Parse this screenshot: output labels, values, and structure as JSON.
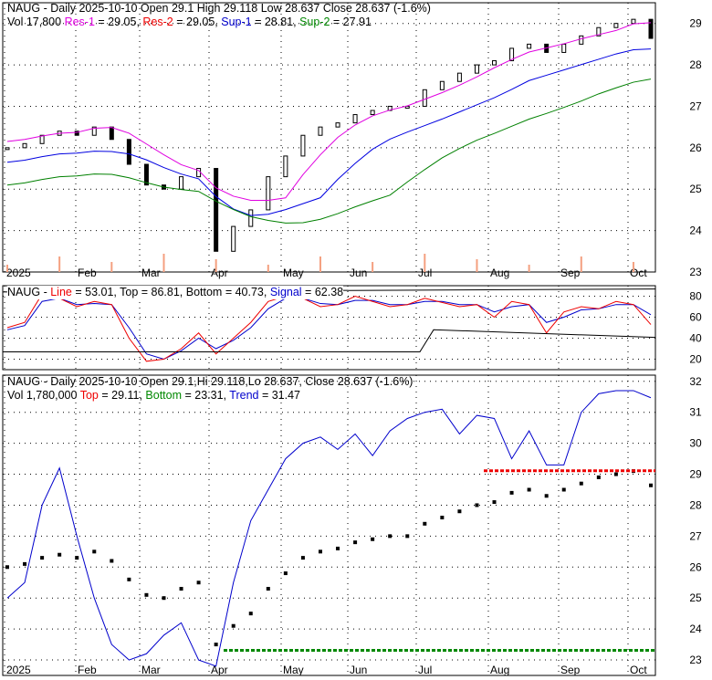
{
  "panel1": {
    "line1": "NAUG - Daily 2025-10-10 Open 29.1  High 29.118  Low 28.637  Close 28.637 (-1.6%)",
    "vol": "Vol 17,800",
    "res1_label": "Res-1",
    "res1": " = 29.05, ",
    "res2_label": "Res-2",
    "res2": " = 29.05, ",
    "sup1_label": "Sup-1",
    "sup1": " = 28.81, ",
    "sup2_label": "Sup-2",
    "sup2": " = 27.91"
  },
  "panel2": {
    "prefix": "NAUG - ",
    "line_label": "Line",
    "line": " = 53.01, Top = 86.81, Bottom = 40.73, ",
    "signal_label": "Signal",
    "signal": " = 62.38"
  },
  "panel3": {
    "line1": "NAUG - Daily 2025-10-10 Open 29.1,Hi 29.118,Lo 28.637, Close 28.637 (-1.6%)",
    "vol": "Vol 1,780,000 ",
    "top_label": "Top",
    "top": " = 29.11, ",
    "bottom_label": "Bottom",
    "bottom": " = 23.31, ",
    "trend_label": "Trend",
    "trend": " = 31.47"
  },
  "chart_data": [
    {
      "type": "line",
      "title": "NAUG - Daily price with support/resistance",
      "ylim": [
        23,
        29.5
      ],
      "y_ticks": [
        23,
        24,
        25,
        26,
        27,
        28,
        29
      ],
      "x_ticks": [
        "2025",
        "Feb",
        "Mar",
        "Apr",
        "May",
        "Jun",
        "Jul",
        "Aug",
        "Sep",
        "Oct"
      ],
      "close": [
        26,
        26.1,
        26.3,
        26.4,
        26.3,
        26.5,
        26.2,
        25.6,
        25.1,
        25.0,
        25.3,
        25.5,
        23.5,
        24.1,
        24.5,
        25.3,
        25.8,
        26.3,
        26.5,
        26.6,
        26.8,
        26.9,
        27.0,
        27.0,
        27.4,
        27.6,
        27.8,
        28.0,
        28.1,
        28.4,
        28.5,
        28.3,
        28.5,
        28.7,
        28.9,
        29.0,
        29.1,
        28.64
      ],
      "colors": {
        "res1": "#e000e0",
        "sup1": "#0000e0",
        "sup2": "#008000",
        "volume": "#f4a080"
      }
    },
    {
      "type": "line",
      "title": "Oscillator",
      "ylim": [
        10,
        90
      ],
      "y_ticks": [
        20,
        40,
        60,
        80
      ],
      "line": [
        50,
        55,
        82,
        78,
        70,
        75,
        72,
        40,
        18,
        20,
        30,
        45,
        25,
        40,
        55,
        75,
        80,
        78,
        70,
        72,
        80,
        75,
        70,
        72,
        78,
        74,
        70,
        72,
        60,
        75,
        72,
        45,
        65,
        70,
        68,
        75,
        72,
        53
      ],
      "signal": [
        48,
        52,
        75,
        78,
        72,
        73,
        72,
        50,
        25,
        20,
        28,
        40,
        30,
        38,
        50,
        68,
        78,
        78,
        73,
        72,
        76,
        76,
        72,
        72,
        75,
        75,
        72,
        72,
        65,
        70,
        72,
        55,
        60,
        67,
        68,
        72,
        72,
        62.38
      ]
    },
    {
      "type": "line",
      "title": "Trend",
      "ylim": [
        22.5,
        32.2
      ],
      "y_ticks": [
        23,
        24,
        25,
        26,
        27,
        28,
        29,
        30,
        31,
        32
      ],
      "trend": [
        25,
        25.5,
        28,
        29.2,
        27,
        25,
        23.5,
        23,
        23.2,
        23.8,
        24.2,
        23.0,
        22.8,
        25.5,
        27.5,
        28.5,
        29.5,
        30.0,
        30.2,
        29.8,
        30.3,
        29.6,
        30.4,
        30.8,
        31.0,
        31.1,
        30.3,
        30.9,
        30.8,
        29.5,
        30.4,
        29.3,
        29.3,
        31.0,
        31.6,
        31.7,
        31.7,
        31.47
      ],
      "top": 29.11,
      "bottom": 23.31
    }
  ]
}
